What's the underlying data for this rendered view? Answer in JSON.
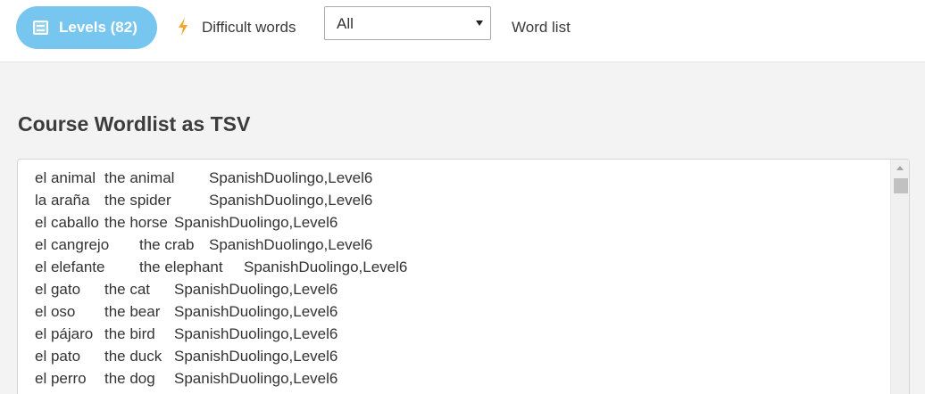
{
  "topbar": {
    "levels_label": "Levels (82)",
    "difficult_label": "Difficult words",
    "filter_value": "All",
    "wordlist_label": "Word list"
  },
  "colors": {
    "levels_button": "#77c6ef",
    "bolt": "#f4a62a"
  },
  "icons": {
    "levels": "list-icon",
    "difficult": "lightning-bolt-icon",
    "select": "chevron-down-icon"
  },
  "main": {
    "title": "Course Wordlist as TSV",
    "entries": [
      {
        "spanish": "el animal",
        "english": "the animal",
        "tags": "SpanishDuolingo,Level6"
      },
      {
        "spanish": "la araña",
        "english": "the spider",
        "tags": "SpanishDuolingo,Level6"
      },
      {
        "spanish": "el caballo",
        "english": "the horse",
        "tags": "SpanishDuolingo,Level6"
      },
      {
        "spanish": "el cangrejo",
        "english": "the crab",
        "tags": "SpanishDuolingo,Level6"
      },
      {
        "spanish": "el elefante",
        "english": "the elephant",
        "tags": "SpanishDuolingo,Level6"
      },
      {
        "spanish": "el gato",
        "english": "the cat",
        "tags": "SpanishDuolingo,Level6"
      },
      {
        "spanish": "el oso",
        "english": "the bear",
        "tags": "SpanishDuolingo,Level6"
      },
      {
        "spanish": "el pájaro",
        "english": "the bird",
        "tags": "SpanishDuolingo,Level6"
      },
      {
        "spanish": "el pato",
        "english": "the duck",
        "tags": "SpanishDuolingo,Level6"
      },
      {
        "spanish": "el perro",
        "english": "the dog",
        "tags": "SpanishDuolingo,Level6"
      }
    ]
  }
}
